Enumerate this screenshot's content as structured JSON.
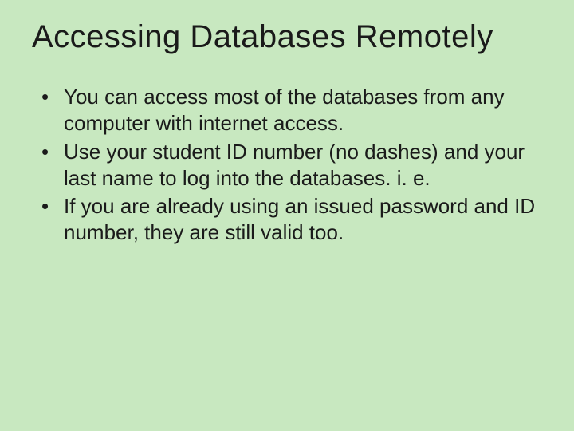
{
  "slide": {
    "title": "Accessing Databases Remotely",
    "bullets": [
      "You can access most of the databases from any computer with internet access.",
      "Use your student ID number (no dashes) and your last name to log into the databases. i. e.",
      "If you are already using an issued password and ID number, they are still valid too."
    ]
  }
}
